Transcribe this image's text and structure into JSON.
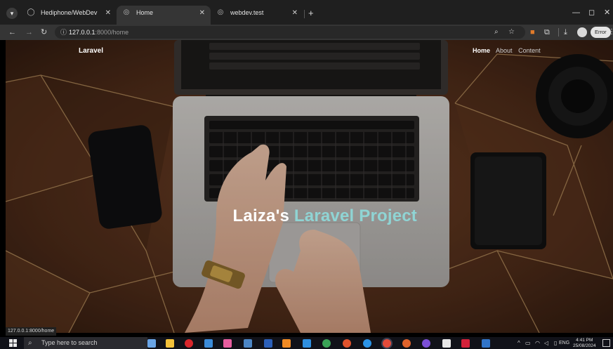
{
  "browser": {
    "tabs": [
      {
        "title": "Hediphone/WebDev",
        "active": false,
        "icon": "github-icon"
      },
      {
        "title": "Home",
        "active": true,
        "icon": "globe-icon"
      },
      {
        "title": "webdev.test",
        "active": false,
        "icon": "globe-icon"
      }
    ],
    "new_tab": "+",
    "url_host": "127.0.0.1",
    "url_path": ":8000/home",
    "profile_badge": "Error",
    "window_controls": {
      "minimize": "—",
      "maximize": "◻",
      "close": "✕"
    }
  },
  "site": {
    "brand": "Laravel",
    "nav": [
      "Home",
      "About",
      "Content"
    ],
    "active_nav": "Home",
    "hero_title_part1": "Laiza's",
    "hero_title_part2": "Laravel Project",
    "accent_color": "#8fd4d4"
  },
  "status_bar": {
    "link_preview": "127.0.0.1:8000/home"
  },
  "taskbar": {
    "search_placeholder": "Type here to search",
    "language": "ENG",
    "time": "4:41 PM",
    "date": "25/08/2024"
  }
}
